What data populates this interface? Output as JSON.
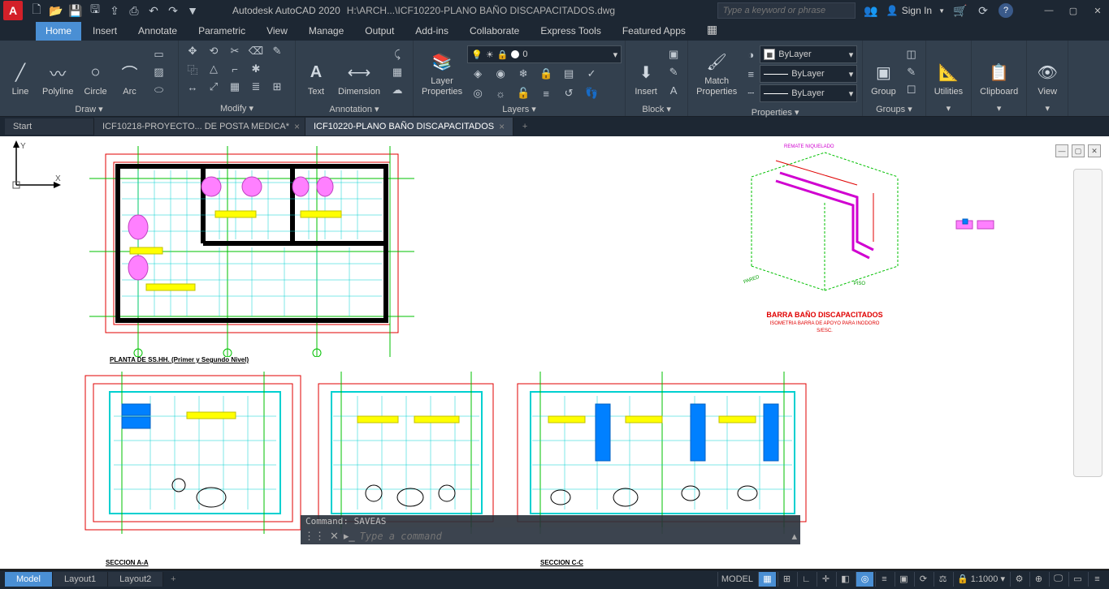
{
  "title": {
    "app": "Autodesk AutoCAD 2020",
    "path": "H:\\ARCH...\\ICF10220-PLANO BAÑO DISCAPACITADOS.dwg",
    "sign_in": "Sign In"
  },
  "search": {
    "placeholder": "Type a keyword or phrase"
  },
  "menubar": {
    "items": [
      "Home",
      "Insert",
      "Annotate",
      "Parametric",
      "View",
      "Manage",
      "Output",
      "Add-ins",
      "Collaborate",
      "Express Tools",
      "Featured Apps"
    ],
    "active": "Home"
  },
  "ribbon": {
    "draw": {
      "label": "Draw ▾",
      "line": "Line",
      "polyline": "Polyline",
      "circle": "Circle",
      "arc": "Arc"
    },
    "modify": {
      "label": "Modify ▾"
    },
    "annotation": {
      "label": "Annotation ▾",
      "text": "Text",
      "dimension": "Dimension"
    },
    "layers": {
      "label": "Layers ▾",
      "panel_btn": "Layer\nProperties",
      "combo": "0"
    },
    "block": {
      "label": "Block ▾",
      "insert": "Insert"
    },
    "properties": {
      "label": "Properties ▾",
      "match": "Match\nProperties",
      "color": "ByLayer",
      "lweight": "ByLayer",
      "ltype": "ByLayer"
    },
    "groups": {
      "label": "Groups ▾",
      "group": "Group"
    },
    "utilities": {
      "label": "Utilities"
    },
    "clipboard": {
      "label": "Clipboard"
    },
    "view": {
      "label": "View"
    }
  },
  "file_tabs": {
    "start": "Start",
    "tab1": "ICF10218-PROYECTO... DE POSTA MEDICA*",
    "tab2": "ICF10220-PLANO BAÑO DISCAPACITADOS",
    "active": 2
  },
  "drawing": {
    "plan_title": "PLANTA DE SS.HH.   (Primer y Segundo Nivel)",
    "iso_title1": "BARRA  BAÑO  DISCAPACITADOS",
    "iso_title2": "ISOMETRIA BARRA DE APOYO PARA INODORO",
    "iso_scale": "S/ESC.",
    "iso_top": "REMATE NIQUELADO",
    "iso_side": "PARED",
    "iso_floor": "PISO",
    "sec_a": "SECCION A-A",
    "sec_c": "SECCION C-C"
  },
  "command": {
    "history": "Command:  SAVEAS",
    "placeholder": "Type a command"
  },
  "layout_tabs": {
    "items": [
      "Model",
      "Layout1",
      "Layout2"
    ],
    "active": "Model"
  },
  "status": {
    "model": "MODEL",
    "scale": "1:1000"
  }
}
